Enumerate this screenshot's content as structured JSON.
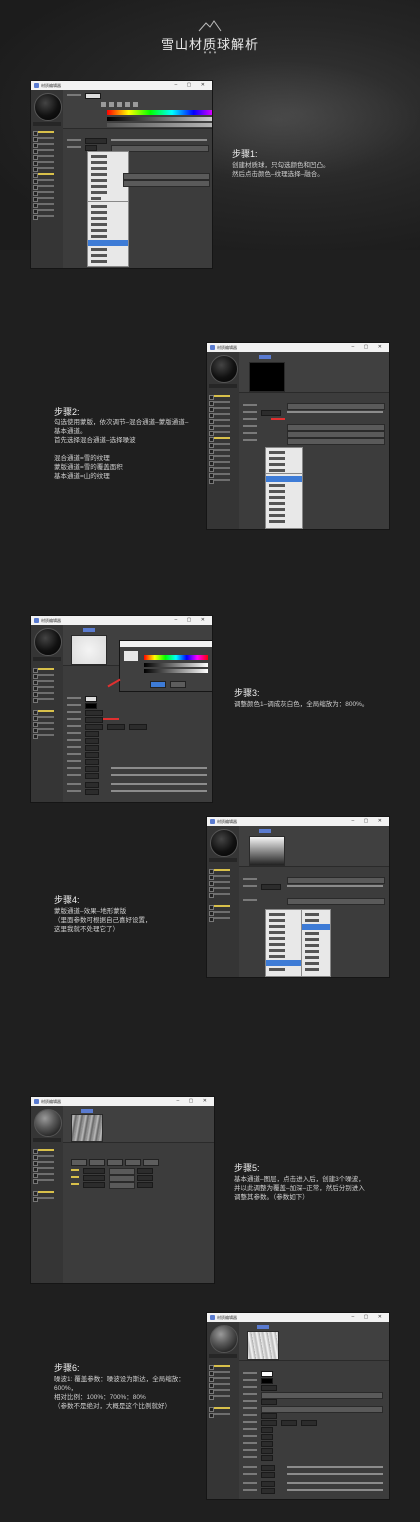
{
  "header": {
    "title": "雪山材质球解析",
    "dots": "• • •"
  },
  "steps": [
    {
      "heading": "步骤1:",
      "text": "创建材质球，只勾选颜色和凹凸。\n然后点击颜色–纹理选择–融合。"
    },
    {
      "heading": "步骤2:",
      "text": "勾选使用蒙版，依次调节–混合通道–蒙版通道–\n基本通道。\n首先选择混合通道–选择噪波\n\n混合通道=雪的纹理\n蒙版通道=雪的覆盖面积\n基本通道=山的纹理"
    },
    {
      "heading": "步骤3:",
      "text": "调整颜色1–调成灰白色，全局缩放为：800%。"
    },
    {
      "heading": "步骤4:",
      "text": "蒙版通道–效果–地形蒙版\n（里面参数可根据自己喜好设置，\n这里我就不处理它了）"
    },
    {
      "heading": "步骤5:",
      "text": "基本通道–图层，点击进入后，创建3个噪波，\n并以此调整为覆盖–加深–正常，然后分别进入\n调整其参数。（参数如下）"
    },
    {
      "heading": "步骤6:",
      "text": "噪波1: 覆盖参数：噪波设为斯达，全局缩放：\n600%，\n相对比例：100%：700%：80%\n（参数不是绝对，大概是这个比例就好）"
    }
  ],
  "editor": {
    "window_title": "材质编辑器",
    "material_name": "材质",
    "colors": {
      "window_bg": "#3c3c3c",
      "titlebar": "#f2f2f2",
      "accent": "#5a7bd0",
      "menu_highlight": "#3d7bd6",
      "checked_channel": "#d8c04a",
      "arrow": "#e03030"
    }
  }
}
